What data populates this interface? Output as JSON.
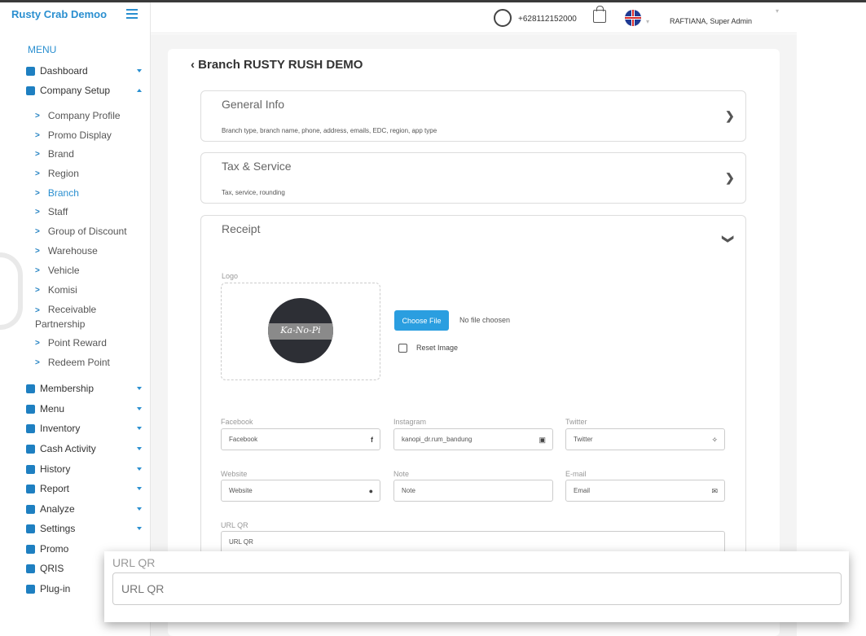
{
  "app": {
    "brand": "Rusty Crab Demoo"
  },
  "topbar": {
    "phone": "+628112152000",
    "user": "RAFTIANA, Super Admin"
  },
  "sidebar": {
    "menu_label": "MENU",
    "items": [
      {
        "label": "Dashboard",
        "icon": "dashboard-icon"
      },
      {
        "label": "Company Setup",
        "icon": "building-icon"
      },
      {
        "label": "Membership",
        "icon": "users-icon"
      },
      {
        "label": "Menu",
        "icon": "utensils-icon"
      },
      {
        "label": "Inventory",
        "icon": "inventory-icon"
      },
      {
        "label": "Cash Activity",
        "icon": "dollar-icon"
      },
      {
        "label": "History",
        "icon": "history-icon"
      },
      {
        "label": "Report",
        "icon": "file-icon"
      },
      {
        "label": "Analyze",
        "icon": "pie-chart-icon"
      },
      {
        "label": "Settings",
        "icon": "gear-icon"
      },
      {
        "label": "Promo",
        "icon": "percent-icon"
      },
      {
        "label": "QRIS",
        "icon": "qr-icon"
      },
      {
        "label": "Plug-in",
        "icon": "plug-icon"
      }
    ],
    "sub_items": [
      "Company Profile",
      "Promo Display",
      "Brand",
      "Region",
      "Branch",
      "Staff",
      "Group of Discount",
      "Warehouse",
      "Vehicle",
      "Komisi",
      "Receivable Partnership",
      "Point Reward",
      "Redeem Point"
    ]
  },
  "page": {
    "title": "Branch RUSTY RUSH DEMO",
    "sections": [
      {
        "title": "General Info",
        "desc": "Branch type, branch name, phone, address, emails, EDC, region, app type"
      },
      {
        "title": "Tax & Service",
        "desc": "Tax, service, rounding"
      },
      {
        "title": "Receipt"
      }
    ],
    "receipt": {
      "logo_label": "Logo",
      "logo_text": "Ka-No-Pi",
      "choose_file": "Choose File",
      "no_file": "No file choosen",
      "reset_image": "Reset Image",
      "fields": [
        {
          "label": "Facebook",
          "value": "Facebook"
        },
        {
          "label": "Instagram",
          "value": "kanopi_dr.rum_bandung"
        },
        {
          "label": "Twitter",
          "value": "Twitter"
        },
        {
          "label": "Website",
          "value": "Website"
        },
        {
          "label": "Note",
          "value": "Note"
        },
        {
          "label": "E-mail",
          "value": "Email"
        },
        {
          "label": "URL QR",
          "value": "URL QR"
        }
      ]
    }
  },
  "zoom": {
    "label": "URL QR",
    "value": "URL QR"
  }
}
